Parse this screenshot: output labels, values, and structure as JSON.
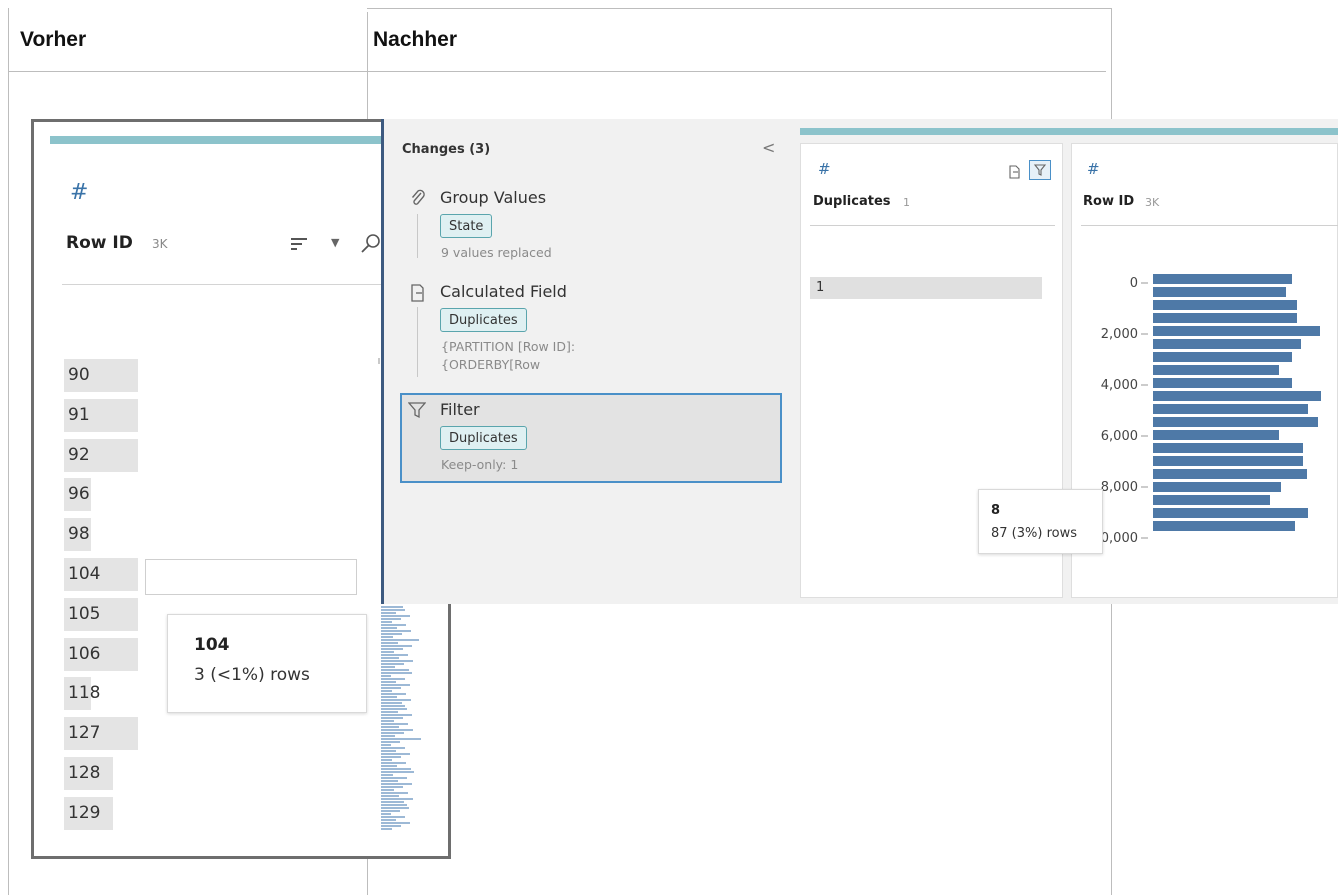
{
  "headers": {
    "before": "Vorher",
    "after": "Nachher"
  },
  "before": {
    "field_title": "Row ID",
    "field_count": "3K",
    "rows": [
      {
        "label": "90",
        "fill": 0.9
      },
      {
        "label": "91",
        "fill": 0.9
      },
      {
        "label": "92",
        "fill": 0.9
      },
      {
        "label": "96",
        "fill": 0.33
      },
      {
        "label": "98",
        "fill": 0.33
      },
      {
        "label": "104",
        "fill": 0.9
      },
      {
        "label": "105",
        "fill": 0.9
      },
      {
        "label": "106",
        "fill": 0.9
      },
      {
        "label": "118",
        "fill": 0.33
      },
      {
        "label": "127",
        "fill": 0.9
      },
      {
        "label": "128",
        "fill": 0.6
      },
      {
        "label": "129",
        "fill": 0.6
      }
    ],
    "tooltip": {
      "value": "104",
      "rows": "3 (<1%) rows"
    },
    "icons": {
      "type": "hash-icon",
      "sort": "sort-icon",
      "dropdown": "chevron-down-icon",
      "search": "search-icon"
    }
  },
  "after": {
    "changes_panel": {
      "title": "Changes (3)",
      "collapse_glyph": "<",
      "items": [
        {
          "icon": "paperclip-icon",
          "name": "Group Values",
          "tag": "State",
          "detail": [
            "9 values replaced"
          ]
        },
        {
          "icon": "calculated-field-icon",
          "name": "Calculated Field",
          "tag": "Duplicates",
          "detail": [
            "{PARTITION [Row ID]:",
            "{ORDERBY[Row"
          ]
        },
        {
          "icon": "filter-icon",
          "name": "Filter",
          "tag": "Duplicates",
          "detail": [
            "Keep-only: 1"
          ]
        }
      ]
    },
    "duplicates_card": {
      "title": "Duplicates",
      "count": "1",
      "value": "1"
    },
    "rowid_card": {
      "title": "Row ID",
      "count": "3K"
    },
    "tooltip": {
      "value": "8",
      "rows": "87 (3%) rows"
    },
    "accent": "#4e79a7"
  },
  "chart_data": {
    "type": "bar",
    "orientation": "horizontal",
    "title": "Row ID",
    "ytick_labels": [
      "0",
      "2,000",
      "4,000",
      "6,000",
      "8,000",
      "10,000"
    ],
    "values": [
      0.75,
      0.72,
      0.78,
      0.78,
      0.9,
      0.8,
      0.75,
      0.68,
      0.75,
      0.91,
      0.84,
      0.89,
      0.68,
      0.81,
      0.81,
      0.83,
      0.69,
      0.63,
      0.84,
      0.77
    ]
  }
}
